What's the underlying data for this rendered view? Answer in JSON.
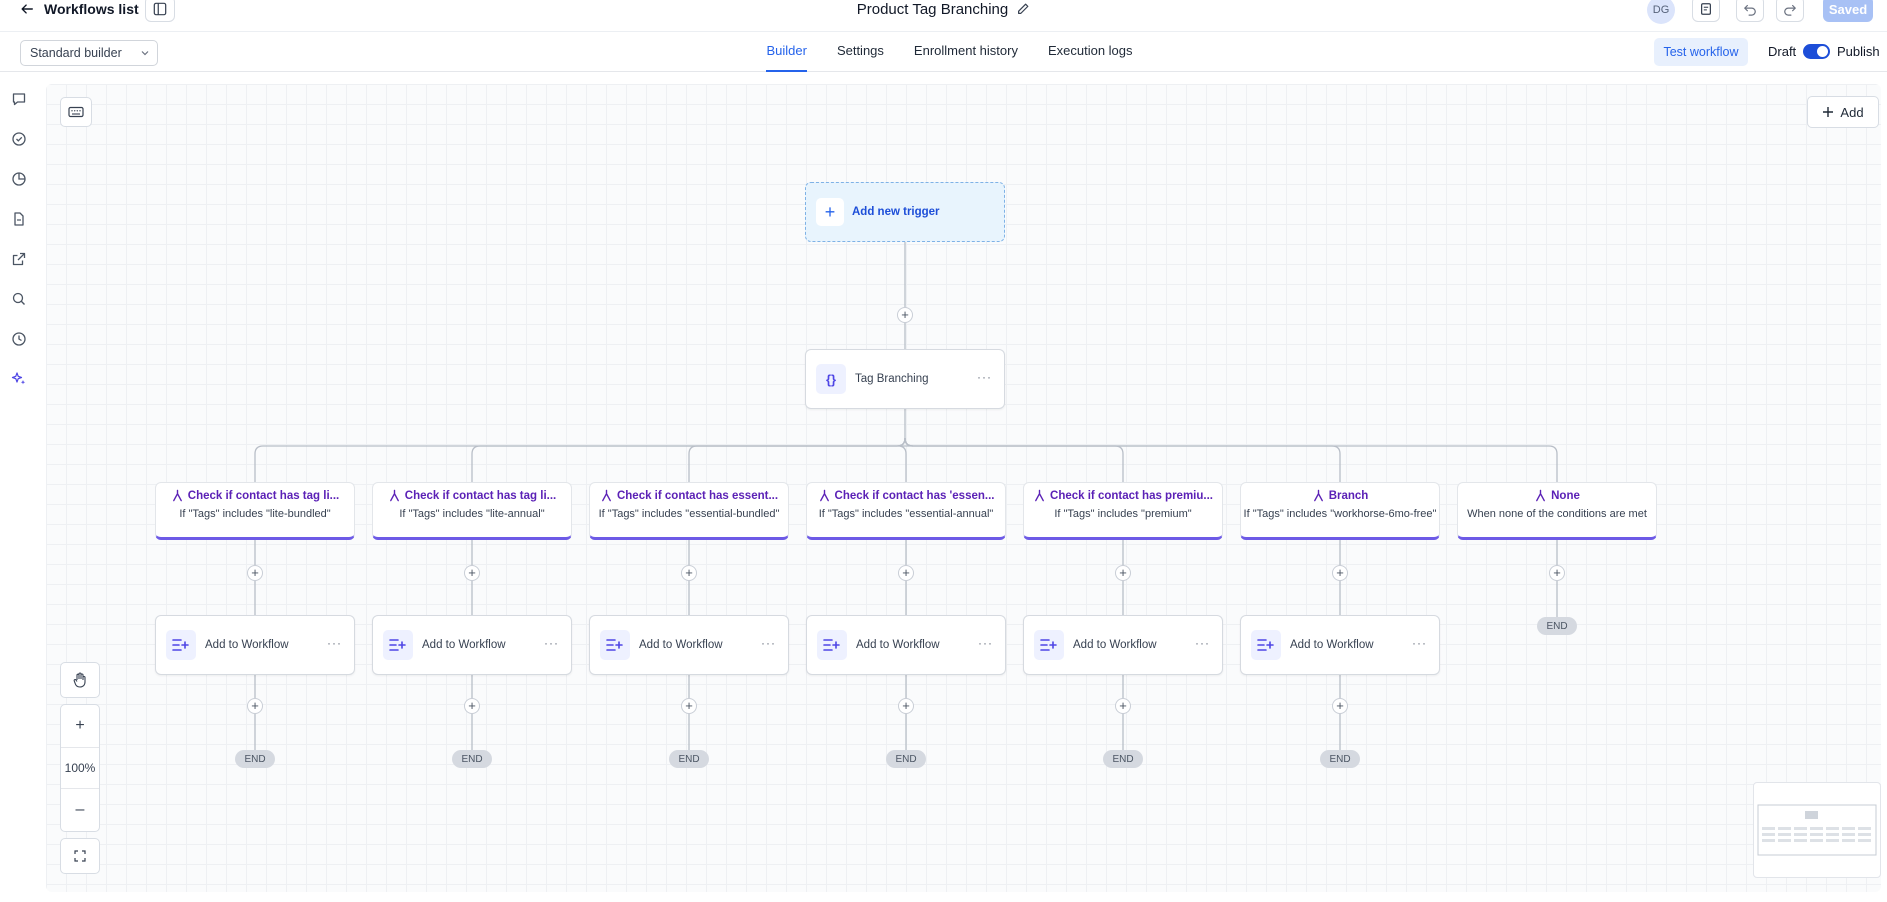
{
  "header": {
    "back_label": "Workflows list",
    "workflow_title": "Product Tag Branching",
    "avatar_initials": "DG",
    "saved_label": "Saved"
  },
  "nav": {
    "builder_select": "Standard builder",
    "tabs": [
      {
        "label": "Builder",
        "active": true
      },
      {
        "label": "Settings",
        "active": false
      },
      {
        "label": "Enrollment history",
        "active": false
      },
      {
        "label": "Execution logs",
        "active": false
      }
    ],
    "test_label": "Test workflow",
    "draft_label": "Draft",
    "publish_label": "Publish",
    "publish_on": true
  },
  "sidebar": {
    "icons": [
      "chat-icon",
      "check-circle-icon",
      "pie-chart-icon",
      "document-icon",
      "external-link-icon",
      "search-icon",
      "history-icon",
      "sparkles-icon"
    ]
  },
  "canvas": {
    "add_label": "Add",
    "trigger_label": "Add new trigger",
    "branching_node": "Tag Branching",
    "branches": [
      {
        "title": "Check if contact has tag li...",
        "condition": "If \"Tags\" includes \"lite-bundled\"",
        "action": "Add to Workflow"
      },
      {
        "title": "Check if contact has tag li...",
        "condition": "If \"Tags\" includes \"lite-annual\"",
        "action": "Add to Workflow"
      },
      {
        "title": "Check if contact has essent...",
        "condition": "If \"Tags\" includes \"essential-bundled\"",
        "action": "Add to Workflow"
      },
      {
        "title": "Check if contact has 'essen...",
        "condition": "If \"Tags\" includes \"essential-annual\"",
        "action": "Add to Workflow"
      },
      {
        "title": "Check if contact has premiu...",
        "condition": "If \"Tags\" includes \"premium\"",
        "action": "Add to Workflow"
      },
      {
        "title": "Branch",
        "condition": "If \"Tags\" includes \"workhorse-6mo-free\"",
        "action": "Add to Workflow"
      },
      {
        "title": "None",
        "condition": "When none of the conditions are met",
        "action": null
      }
    ],
    "end_label": "END",
    "zoom_level": "100%"
  },
  "colors": {
    "accent": "#2563eb",
    "branch_accent": "#6d5ae6",
    "saved_bg": "#a8c1f5"
  }
}
